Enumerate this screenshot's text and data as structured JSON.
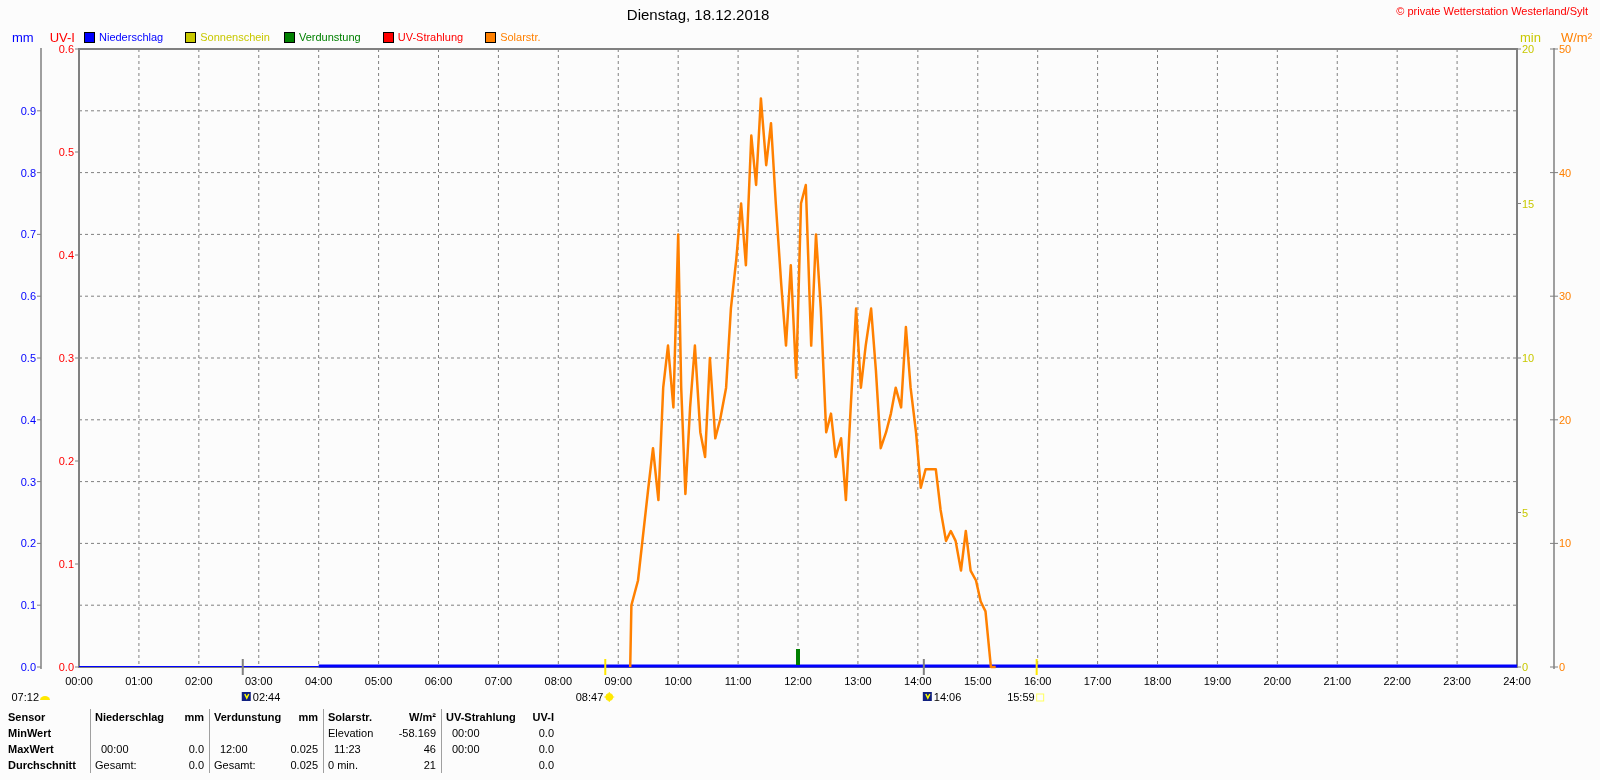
{
  "title": "Dienstag, 18.12.2018",
  "copyright": "© private Wetterstation Westerland/Sylt",
  "axes": [
    {
      "unit": "mm",
      "kind": "open-top",
      "color": "#0000ff",
      "ticks": [
        "0.9",
        "0.8",
        "0.7",
        "0.6",
        "0.5",
        "0.4",
        "0.3",
        "0.2",
        "0.1",
        "0.0"
      ]
    },
    {
      "unit": "UV-I",
      "kind": "full",
      "color": "#ff0000",
      "ticks": [
        "0.6",
        "0.5",
        "0.4",
        "0.3",
        "0.2",
        "0.1",
        "0.0"
      ]
    },
    {
      "unit": "min",
      "kind": "full",
      "color": "#c8c800",
      "ticks": [
        "20",
        "15",
        "10",
        "5",
        "0"
      ]
    }
  ],
  "legend": [
    {
      "label": "Niederschlag",
      "color": "#0000ff"
    },
    {
      "label": "Sonnenschein",
      "color": "#c8c800"
    },
    {
      "label": "Verdunstung",
      "color": "#008000"
    },
    {
      "label": "UV-Strahlung",
      "color": "#ff0000"
    }
  ],
  "chart_data": {
    "type": "line",
    "xlim": [
      0,
      24
    ],
    "ylim": [
      0,
      50
    ],
    "ylabel": "W/m²",
    "grid": true,
    "xticks": [
      {
        "value": 0,
        "label": "00:00"
      },
      {
        "value": 1,
        "label": "01:00"
      },
      {
        "value": 2,
        "label": "02:00"
      },
      {
        "value": 3,
        "label": "03:00"
      },
      {
        "value": 4,
        "label": "04:00"
      },
      {
        "value": 5,
        "label": "05:00"
      },
      {
        "value": 6,
        "label": "06:00"
      },
      {
        "value": 7,
        "label": "07:00"
      },
      {
        "value": 8,
        "label": "08:00"
      },
      {
        "value": 9,
        "label": "09:00"
      },
      {
        "value": 10,
        "label": "10:00"
      },
      {
        "value": 11,
        "label": "11:00"
      },
      {
        "value": 12,
        "label": "12:00"
      },
      {
        "value": 13,
        "label": "13:00"
      },
      {
        "value": 14,
        "label": "14:00"
      },
      {
        "value": 15,
        "label": "15:00"
      },
      {
        "value": 16,
        "label": "16:00"
      },
      {
        "value": 17,
        "label": "17:00"
      },
      {
        "value": 18,
        "label": "18:00"
      },
      {
        "value": 19,
        "label": "19:00"
      },
      {
        "value": 20,
        "label": "20:00"
      },
      {
        "value": 21,
        "label": "21:00"
      },
      {
        "value": 22,
        "label": "22:00"
      },
      {
        "value": 23,
        "label": "23:00"
      },
      {
        "value": 24,
        "label": "24:00"
      }
    ],
    "yticks": [
      0,
      10,
      20,
      30,
      40,
      50
    ],
    "x": [
      9.2,
      9.22,
      9.33,
      9.5,
      9.58,
      9.67,
      9.75,
      9.83,
      9.92,
      10.0,
      10.05,
      10.12,
      10.2,
      10.28,
      10.37,
      10.45,
      10.53,
      10.62,
      10.7,
      10.8,
      10.88,
      10.97,
      11.05,
      11.13,
      11.22,
      11.3,
      11.38,
      11.47,
      11.55,
      11.63,
      11.72,
      11.8,
      11.88,
      11.97,
      12.05,
      12.13,
      12.22,
      12.3,
      12.38,
      12.47,
      12.55,
      12.63,
      12.72,
      12.8,
      12.88,
      12.97,
      13.05,
      13.13,
      13.22,
      13.3,
      13.38,
      13.47,
      13.55,
      13.63,
      13.72,
      13.8,
      13.88,
      13.97,
      14.05,
      14.13,
      14.22,
      14.3,
      14.38,
      14.47,
      14.55,
      14.63,
      14.72,
      14.8,
      14.88,
      14.97,
      15.05,
      15.13,
      15.22,
      15.3
    ],
    "series": [
      {
        "name": "Solarstr.",
        "color": "#ff8000",
        "values": [
          0,
          5,
          7,
          14.4,
          17.7,
          13.5,
          22.6,
          26,
          21,
          35,
          22.6,
          14,
          21,
          26,
          19,
          17,
          25,
          18.5,
          20,
          22.6,
          29,
          33,
          37.5,
          32.5,
          43,
          39,
          46,
          40.6,
          44,
          37.5,
          31,
          26,
          32.5,
          23.4,
          37.5,
          39,
          26,
          35,
          29,
          19,
          20.5,
          17,
          18.5,
          13.5,
          21,
          29,
          22.6,
          26,
          29,
          24,
          17.7,
          19,
          20.5,
          22.6,
          21,
          27.5,
          22.6,
          19,
          14.5,
          16,
          16,
          16,
          12.7,
          10.2,
          11,
          10.2,
          7.8,
          11,
          7.8,
          7,
          5.3,
          4.5,
          0,
          0
        ]
      }
    ]
  },
  "markers": [
    {
      "time": "07:12",
      "kind": "half-sun"
    },
    {
      "time": "02:44",
      "kind": "night"
    },
    {
      "time": "08:47",
      "kind": "sun"
    },
    {
      "time": "14:06",
      "kind": "night"
    },
    {
      "time": "15:59",
      "kind": "outline"
    }
  ],
  "table": {
    "row_labels": [
      "Sensor",
      "MinWert",
      "MaxWert",
      "Durchschnitt"
    ],
    "groups": [
      {
        "title": "Niederschlag",
        "unit": "mm",
        "rows": [
          {},
          {
            "label": "00:00",
            "value": "0.0"
          },
          {
            "label": "Gesamt:",
            "value": "0.0"
          }
        ]
      },
      {
        "title": "Verdunstung",
        "unit": "mm",
        "rows": [
          {},
          {
            "label": "12:00",
            "value": "0.025"
          },
          {
            "label": "Gesamt:",
            "value": "0.025"
          }
        ]
      },
      {
        "title": "Solarstr.",
        "unit": "W/m²",
        "rows": [
          {
            "label": "Elevation",
            "value": "-58.169"
          },
          {
            "label": "11:23",
            "value": "46"
          },
          {
            "label": "0 min.",
            "value": "21"
          }
        ]
      },
      {
        "title": "UV-Strahlung",
        "unit": "UV-I",
        "rows": [
          {
            "label": "00:00",
            "value": "0.0"
          },
          {
            "label": "00:00",
            "value": "0.0"
          },
          {
            "value": "0.0"
          }
        ]
      }
    ]
  }
}
